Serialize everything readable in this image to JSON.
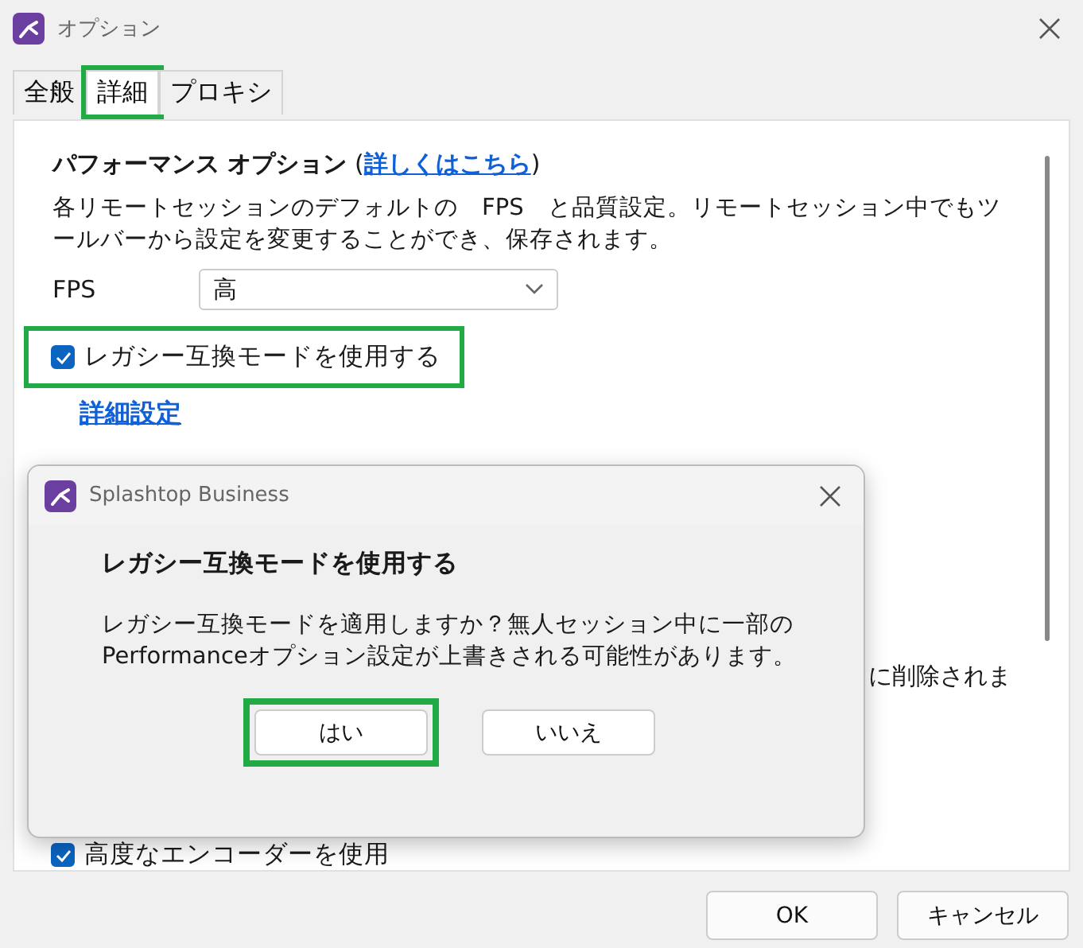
{
  "window": {
    "title": "オプション"
  },
  "tabs": [
    {
      "label": "全般",
      "selected": false,
      "highlighted": false
    },
    {
      "label": "詳細",
      "selected": true,
      "highlighted": true
    },
    {
      "label": "プロキシ",
      "selected": false,
      "highlighted": false
    }
  ],
  "performance": {
    "heading": "パフォーマンス オプション",
    "paren_open": "(",
    "link": "詳しくはこちら",
    "paren_close": ")",
    "description": "各リモートセッションのデフォルトの　FPS　と品質設定。リモートセッション中でもツールバーから設定を変更することができ、保存されます。",
    "fps_label": "FPS",
    "fps_value": "高"
  },
  "legacy_checkbox": {
    "label": "レガシー互換モードを使用する",
    "checked": true,
    "highlighted": true
  },
  "details_link": "詳細設定",
  "hidden_text": "に削除されま",
  "encoder_checkbox": {
    "label": "高度なエンコーダーを使用",
    "checked": true
  },
  "buttons": [
    {
      "label": "OK"
    },
    {
      "label": "キャンセル"
    }
  ],
  "dialog": {
    "title": "Splashtop Business",
    "heading": "レガシー互換モードを使用する",
    "message": "レガシー互換モードを適用しますか？無人セッション中に一部のPerformanceオプション設定が上書きされる可能性があります。",
    "buttons": [
      {
        "label": "はい",
        "highlighted": true
      },
      {
        "label": "いいえ",
        "highlighted": false
      }
    ]
  }
}
